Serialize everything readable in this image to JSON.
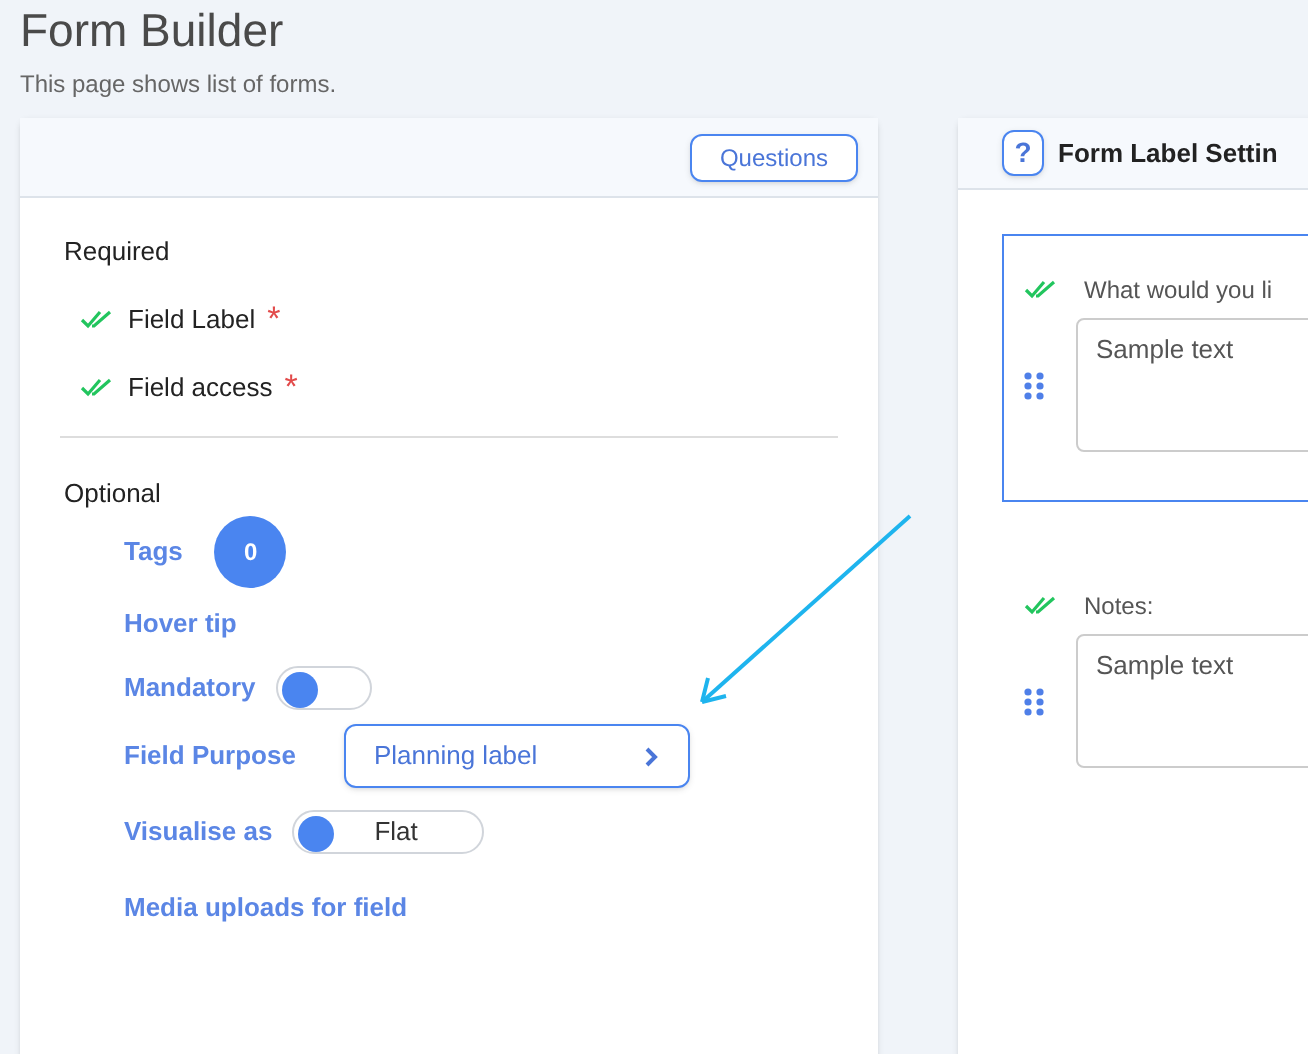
{
  "page": {
    "title": "Form Builder",
    "subtitle": "This page shows list of forms."
  },
  "left_panel": {
    "header_button": "Questions",
    "required": {
      "heading": "Required",
      "items": [
        {
          "label": "Field Label",
          "checked": true,
          "mark": "*"
        },
        {
          "label": "Field access",
          "checked": true,
          "mark": "*"
        }
      ]
    },
    "optional": {
      "heading": "Optional",
      "items": [
        {
          "kind": "count",
          "label": "Tags",
          "count": "0"
        },
        {
          "kind": "link",
          "label": "Hover tip"
        },
        {
          "kind": "toggle",
          "label": "Mandatory",
          "on": false
        },
        {
          "kind": "select",
          "label": "Field Purpose",
          "value": "Planning label"
        },
        {
          "kind": "toggle",
          "label": "Visualise as",
          "on": false,
          "value": "Flat"
        },
        {
          "kind": "link",
          "label": "Media uploads for field"
        }
      ]
    }
  },
  "right_panel": {
    "help_icon": "?",
    "title": "Form Label Settin",
    "questions": [
      {
        "label": "What would you li",
        "checked": true,
        "focused": true,
        "value": "Sample text"
      },
      {
        "label": "Notes:",
        "checked": true,
        "focused": false,
        "value": "Sample text"
      }
    ]
  }
}
